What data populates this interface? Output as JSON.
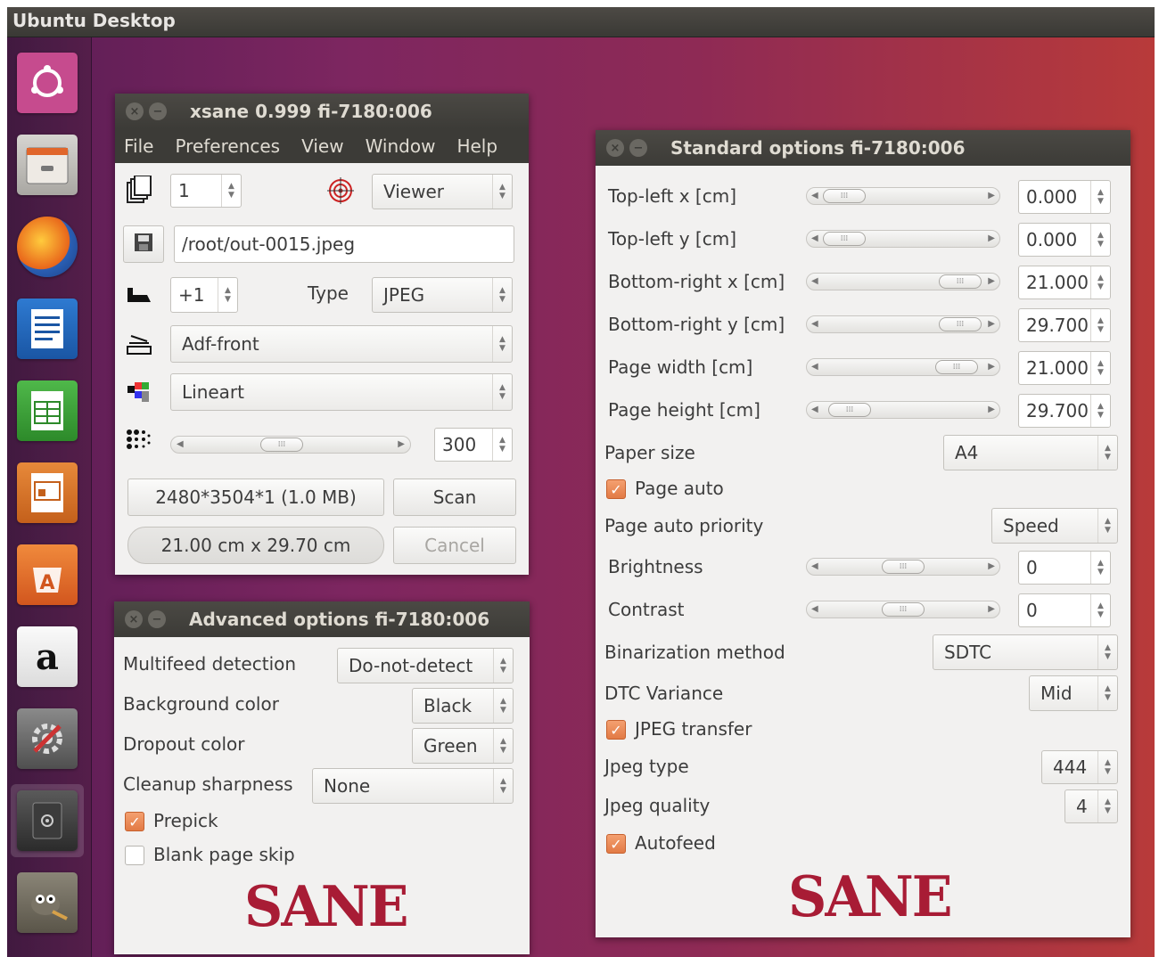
{
  "topbar": {
    "title": "Ubuntu Desktop"
  },
  "launcher": {
    "items": [
      "ubuntu-icon",
      "files-icon",
      "firefox-icon",
      "writer-icon",
      "calc-icon",
      "impress-icon",
      "software-center-icon",
      "amazon-icon",
      "settings-icon",
      "scanner-icon",
      "gimp-icon"
    ]
  },
  "xsane": {
    "title": "xsane 0.999 fi-7180:006",
    "menu": [
      "File",
      "Preferences",
      "View",
      "Window",
      "Help"
    ],
    "copies": "1",
    "viewer": "Viewer",
    "filename": "/root/out-0015.jpeg",
    "increment": "+1",
    "type_label": "Type",
    "type_value": "JPEG",
    "source": "Adf-front",
    "mode": "Lineart",
    "resolution": "300",
    "info_size": "2480*3504*1 (1.0 MB)",
    "info_dims": "21.00 cm x 29.70 cm",
    "scan": "Scan",
    "cancel": "Cancel"
  },
  "advanced": {
    "title": "Advanced options fi-7180:006",
    "multifeed_label": "Multifeed detection",
    "multifeed_value": "Do-not-detect",
    "bg_label": "Background color",
    "bg_value": "Black",
    "dropout_label": "Dropout color",
    "dropout_value": "Green",
    "cleanup_label": "Cleanup sharpness",
    "cleanup_value": "None",
    "prepick_label": "Prepick",
    "blank_label": "Blank page skip",
    "logo": "SANE"
  },
  "standard": {
    "title": "Standard options fi-7180:006",
    "tlx_label": "Top-left x [cm]",
    "tlx_value": "0.000",
    "tly_label": "Top-left y [cm]",
    "tly_value": "0.000",
    "brx_label": "Bottom-right x [cm]",
    "brx_value": "21.000",
    "bry_label": "Bottom-right y [cm]",
    "bry_value": "29.700",
    "pw_label": "Page width [cm]",
    "pw_value": "21.000",
    "ph_label": "Page height [cm]",
    "ph_value": "29.700",
    "paper_label": "Paper size",
    "paper_value": "A4",
    "pageauto_label": "Page auto",
    "pap_label": "Page auto priority",
    "pap_value": "Speed",
    "brightness_label": "Brightness",
    "brightness_value": "0",
    "contrast_label": "Contrast",
    "contrast_value": "0",
    "bin_label": "Binarization method",
    "bin_value": "SDTC",
    "dtc_label": "DTC Variance",
    "dtc_value": "Mid",
    "jpegtx_label": "JPEG transfer",
    "jtype_label": "Jpeg type",
    "jtype_value": "444",
    "jqual_label": "Jpeg quality",
    "jqual_value": "4",
    "autofeed_label": "Autofeed",
    "logo": "SANE"
  }
}
